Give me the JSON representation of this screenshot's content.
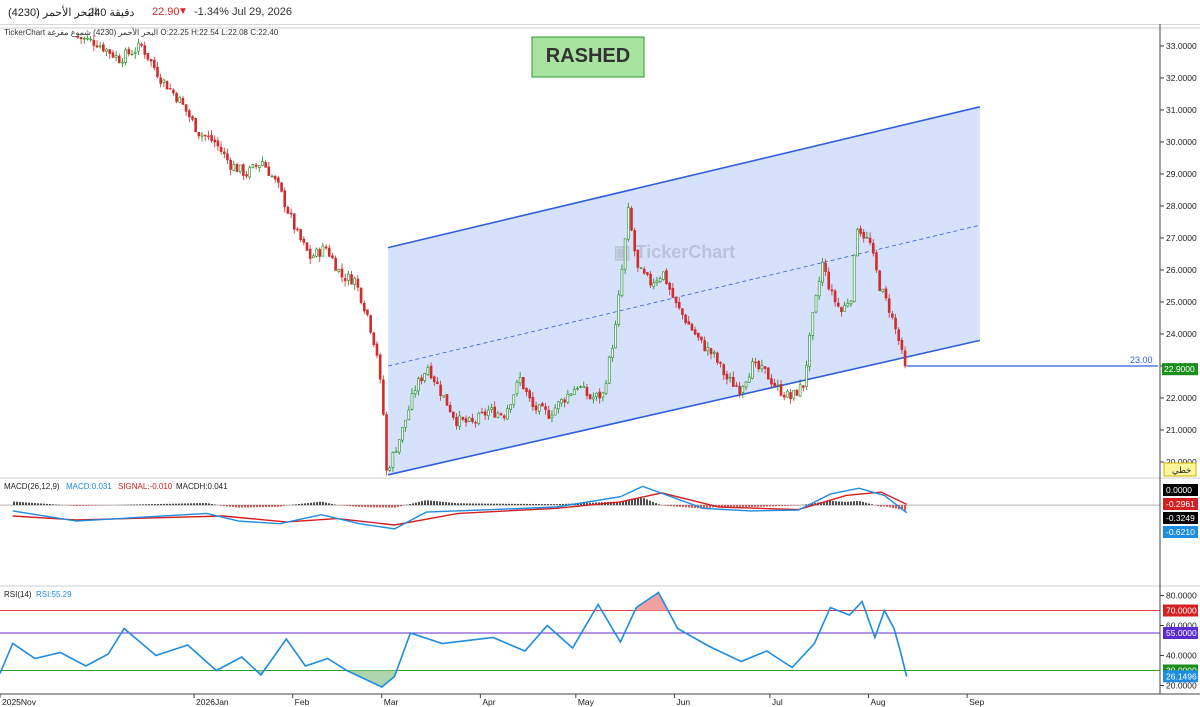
{
  "header": {
    "symbol": "البحر الأحمر (4230)",
    "timeframe": "240 دقيقة",
    "price": "22.90",
    "change": "-1.34%",
    "date": "Jul 29, 2026",
    "down_arrow_icon": "triangle-down-icon"
  },
  "info_line": {
    "source": "TickerChart",
    "symbol": "البحر الأحمر (4230)",
    "chart_kind": "شموع مفرغة",
    "ohlc": "O:22.25  H:22.54  L:22.08  C:22.40"
  },
  "watermark": {
    "label": "RASHED",
    "brand": "TickerChart"
  },
  "price_line_label": "23.00",
  "last_price_tag": "22.9000",
  "draw_tool_label": "خطي",
  "colors": {
    "up": "#1a8a1a",
    "down": "#d32b2b",
    "channel_line": "#2f5fe0",
    "channel_fill": "#d6e1fb",
    "macd_line": "#1e8ce0",
    "signal_line": "#d42020",
    "rsi_line": "#1e8ce0",
    "rsi_fill": "#9fcf9f",
    "level_70": "#e04040",
    "level_55": "#6a2bd0",
    "level_30": "#2aa02a"
  },
  "chart_data": [
    {
      "type": "candlestick",
      "title": "",
      "y_range": [
        19.5,
        33.5
      ],
      "y_ticks": [
        "33.0000",
        "32.0000",
        "31.0000",
        "30.0000",
        "29.0000",
        "28.0000",
        "27.0000",
        "26.0000",
        "25.0000",
        "24.0000",
        "23.0000",
        "22.0000",
        "21.0000",
        "20.0000"
      ],
      "x_labels": [
        "2025Nov",
        "2026Jan",
        "Feb",
        "Mar",
        "Apr",
        "May",
        "Jun",
        "Jul",
        "Aug",
        "Sep"
      ],
      "close_path": [
        {
          "d": "2025-11-25",
          "v": 33.3
        },
        {
          "d": "2025-12-02",
          "v": 33.1
        },
        {
          "d": "2025-12-09",
          "v": 32.6
        },
        {
          "d": "2025-12-16",
          "v": 33.0
        },
        {
          "d": "2025-12-22",
          "v": 32.0
        },
        {
          "d": "2025-12-28",
          "v": 31.3
        },
        {
          "d": "2026-01-03",
          "v": 30.3
        },
        {
          "d": "2026-01-08",
          "v": 30.0
        },
        {
          "d": "2026-01-13",
          "v": 29.3
        },
        {
          "d": "2026-01-18",
          "v": 29.0
        },
        {
          "d": "2026-01-23",
          "v": 29.4
        },
        {
          "d": "2026-01-28",
          "v": 28.6
        },
        {
          "d": "2026-02-03",
          "v": 27.1
        },
        {
          "d": "2026-02-07",
          "v": 26.4
        },
        {
          "d": "2026-02-12",
          "v": 26.7
        },
        {
          "d": "2026-02-17",
          "v": 25.8
        },
        {
          "d": "2026-02-21",
          "v": 25.7
        },
        {
          "d": "2026-02-25",
          "v": 24.6
        },
        {
          "d": "2026-02-28",
          "v": 23.4
        },
        {
          "d": "2026-03-02",
          "v": 21.5
        },
        {
          "d": "2026-03-03",
          "v": 19.7
        },
        {
          "d": "2026-03-05",
          "v": 20.2
        },
        {
          "d": "2026-03-08",
          "v": 21.0
        },
        {
          "d": "2026-03-12",
          "v": 22.3
        },
        {
          "d": "2026-03-16",
          "v": 23.0
        },
        {
          "d": "2026-03-20",
          "v": 22.2
        },
        {
          "d": "2026-03-25",
          "v": 21.3
        },
        {
          "d": "2026-03-30",
          "v": 21.2
        },
        {
          "d": "2026-04-04",
          "v": 21.6
        },
        {
          "d": "2026-04-09",
          "v": 21.5
        },
        {
          "d": "2026-04-14",
          "v": 22.6
        },
        {
          "d": "2026-04-18",
          "v": 21.7
        },
        {
          "d": "2026-04-23",
          "v": 21.5
        },
        {
          "d": "2026-04-28",
          "v": 22.0
        },
        {
          "d": "2026-05-02",
          "v": 22.4
        },
        {
          "d": "2026-05-06",
          "v": 22.0
        },
        {
          "d": "2026-05-10",
          "v": 22.1
        },
        {
          "d": "2026-05-14",
          "v": 24.2
        },
        {
          "d": "2026-05-18",
          "v": 27.8
        },
        {
          "d": "2026-05-21",
          "v": 26.0
        },
        {
          "d": "2026-05-25",
          "v": 25.6
        },
        {
          "d": "2026-05-29",
          "v": 25.9
        },
        {
          "d": "2026-06-02",
          "v": 24.9
        },
        {
          "d": "2026-06-06",
          "v": 24.3
        },
        {
          "d": "2026-06-10",
          "v": 23.7
        },
        {
          "d": "2026-06-14",
          "v": 23.3
        },
        {
          "d": "2026-06-18",
          "v": 22.6
        },
        {
          "d": "2026-06-22",
          "v": 22.3
        },
        {
          "d": "2026-06-26",
          "v": 23.0
        },
        {
          "d": "2026-06-30",
          "v": 22.8
        },
        {
          "d": "2026-07-04",
          "v": 22.3
        },
        {
          "d": "2026-07-08",
          "v": 22.0
        },
        {
          "d": "2026-07-12",
          "v": 22.4
        },
        {
          "d": "2026-07-15",
          "v": 24.5
        },
        {
          "d": "2026-07-18",
          "v": 26.2
        },
        {
          "d": "2026-07-21",
          "v": 25.2
        },
        {
          "d": "2026-07-24",
          "v": 24.7
        },
        {
          "d": "2026-07-27",
          "v": 25.2
        },
        {
          "d": "2026-07-29",
          "v": 27.4
        },
        {
          "d": "2026-08-02",
          "v": 26.8
        },
        {
          "d": "2026-08-05",
          "v": 25.5
        },
        {
          "d": "2026-08-08",
          "v": 24.8
        },
        {
          "d": "2026-08-11",
          "v": 23.8
        },
        {
          "d": "2026-08-13",
          "v": 22.9
        }
      ],
      "channel": {
        "upper": [
          {
            "d": "2026-03-03",
            "v": 26.7
          },
          {
            "d": "2026-09-05",
            "v": 31.1
          }
        ],
        "middle": [
          {
            "d": "2026-03-03",
            "v": 23.0
          },
          {
            "d": "2026-09-05",
            "v": 27.4
          }
        ],
        "lower": [
          {
            "d": "2026-03-03",
            "v": 19.6
          },
          {
            "d": "2026-09-05",
            "v": 23.8
          }
        ]
      },
      "horizontal_line": {
        "from": "2026-08-13",
        "to": "2026-10-31",
        "value": 23.0
      }
    },
    {
      "type": "line",
      "title": "MACD(26,12,9)",
      "legend": [
        "MACD(26,12,9)",
        "MACD:0.031",
        "SIGNAL:-0.010",
        "MACDH:0.041"
      ],
      "axis_values": [
        "0.0000",
        "-0.2961",
        "-0.3249",
        "-0.6210"
      ],
      "y_range": [
        -1.45,
        0.65
      ],
      "macd": [
        {
          "d": "2025-11-05",
          "v": -0.55
        },
        {
          "d": "2025-11-25",
          "v": -0.95
        },
        {
          "d": "2025-12-15",
          "v": -0.8
        },
        {
          "d": "2026-01-05",
          "v": -0.65
        },
        {
          "d": "2026-01-15",
          "v": -0.95
        },
        {
          "d": "2026-01-28",
          "v": -1.05
        },
        {
          "d": "2026-02-10",
          "v": -0.7
        },
        {
          "d": "2026-02-22",
          "v": -1.05
        },
        {
          "d": "2026-03-05",
          "v": -1.25
        },
        {
          "d": "2026-03-15",
          "v": -0.6
        },
        {
          "d": "2026-04-05",
          "v": -0.5
        },
        {
          "d": "2026-04-25",
          "v": -0.4
        },
        {
          "d": "2026-05-15",
          "v": 0.0
        },
        {
          "d": "2026-05-22",
          "v": 0.4
        },
        {
          "d": "2026-06-10",
          "v": -0.45
        },
        {
          "d": "2026-06-25",
          "v": -0.55
        },
        {
          "d": "2026-07-10",
          "v": -0.52
        },
        {
          "d": "2026-07-20",
          "v": 0.1
        },
        {
          "d": "2026-07-29",
          "v": 0.33
        },
        {
          "d": "2026-08-06",
          "v": 0.05
        },
        {
          "d": "2026-08-13",
          "v": -0.62
        }
      ],
      "signal": [
        {
          "d": "2025-11-05",
          "v": -0.75
        },
        {
          "d": "2025-11-25",
          "v": -0.9
        },
        {
          "d": "2025-12-20",
          "v": -0.82
        },
        {
          "d": "2026-01-10",
          "v": -0.75
        },
        {
          "d": "2026-01-30",
          "v": -0.98
        },
        {
          "d": "2026-02-15",
          "v": -0.85
        },
        {
          "d": "2026-03-05",
          "v": -1.1
        },
        {
          "d": "2026-03-25",
          "v": -0.65
        },
        {
          "d": "2026-04-25",
          "v": -0.45
        },
        {
          "d": "2026-05-15",
          "v": -0.2
        },
        {
          "d": "2026-05-28",
          "v": 0.15
        },
        {
          "d": "2026-06-15",
          "v": -0.4
        },
        {
          "d": "2026-07-10",
          "v": -0.5
        },
        {
          "d": "2026-07-25",
          "v": 0.05
        },
        {
          "d": "2026-08-05",
          "v": 0.18
        },
        {
          "d": "2026-08-13",
          "v": -0.3
        }
      ]
    },
    {
      "type": "line",
      "title": "RSI(14)",
      "legend": [
        "RSI(14)",
        "RSI:55.29"
      ],
      "axis_values": [
        "80.0000",
        "70.0000",
        "60.0000",
        "55.0000",
        "40.0000",
        "30.0000",
        "26.1496",
        "20.0000"
      ],
      "levels": [
        70,
        55,
        30
      ],
      "y_range": [
        17,
        85
      ],
      "rsi": [
        {
          "d": "2025-11-01",
          "v": 28
        },
        {
          "d": "2025-11-05",
          "v": 48
        },
        {
          "d": "2025-11-12",
          "v": 38
        },
        {
          "d": "2025-11-20",
          "v": 42
        },
        {
          "d": "2025-11-28",
          "v": 33
        },
        {
          "d": "2025-12-05",
          "v": 41
        },
        {
          "d": "2025-12-10",
          "v": 58
        },
        {
          "d": "2025-12-20",
          "v": 40
        },
        {
          "d": "2025-12-30",
          "v": 47
        },
        {
          "d": "2026-01-08",
          "v": 30
        },
        {
          "d": "2026-01-16",
          "v": 39
        },
        {
          "d": "2026-01-22",
          "v": 27
        },
        {
          "d": "2026-01-30",
          "v": 51
        },
        {
          "d": "2026-02-05",
          "v": 33
        },
        {
          "d": "2026-02-12",
          "v": 38
        },
        {
          "d": "2026-02-18",
          "v": 30
        },
        {
          "d": "2026-02-24",
          "v": 24
        },
        {
          "d": "2026-03-01",
          "v": 19
        },
        {
          "d": "2026-03-05",
          "v": 26
        },
        {
          "d": "2026-03-10",
          "v": 55
        },
        {
          "d": "2026-03-20",
          "v": 48
        },
        {
          "d": "2026-04-05",
          "v": 52
        },
        {
          "d": "2026-04-15",
          "v": 43
        },
        {
          "d": "2026-04-22",
          "v": 60
        },
        {
          "d": "2026-04-30",
          "v": 45
        },
        {
          "d": "2026-05-08",
          "v": 74
        },
        {
          "d": "2026-05-15",
          "v": 49
        },
        {
          "d": "2026-05-20",
          "v": 72
        },
        {
          "d": "2026-05-27",
          "v": 82
        },
        {
          "d": "2026-06-02",
          "v": 58
        },
        {
          "d": "2026-06-12",
          "v": 46
        },
        {
          "d": "2026-06-22",
          "v": 36
        },
        {
          "d": "2026-06-30",
          "v": 43
        },
        {
          "d": "2026-07-08",
          "v": 32
        },
        {
          "d": "2026-07-15",
          "v": 48
        },
        {
          "d": "2026-07-20",
          "v": 72
        },
        {
          "d": "2026-07-26",
          "v": 67
        },
        {
          "d": "2026-07-30",
          "v": 76
        },
        {
          "d": "2026-08-03",
          "v": 52
        },
        {
          "d": "2026-08-06",
          "v": 70
        },
        {
          "d": "2026-08-09",
          "v": 58
        },
        {
          "d": "2026-08-11",
          "v": 43
        },
        {
          "d": "2026-08-13",
          "v": 26
        }
      ]
    }
  ]
}
